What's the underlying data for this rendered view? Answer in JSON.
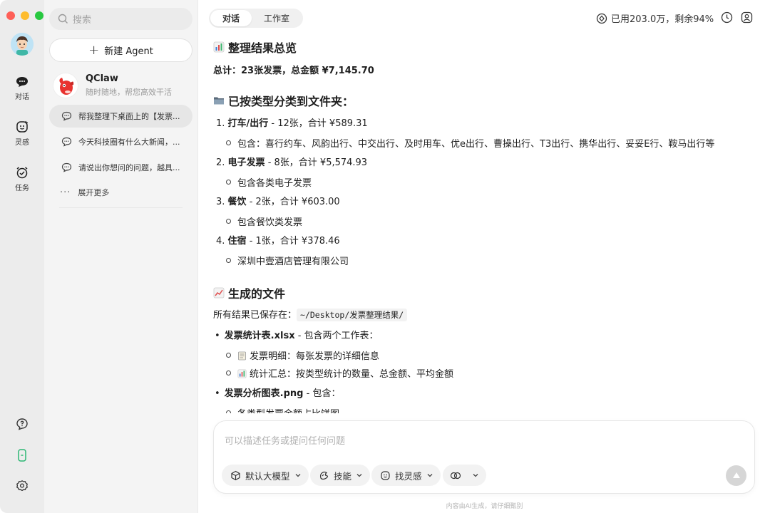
{
  "rail": {
    "items": [
      {
        "label": "对话"
      },
      {
        "label": "灵感"
      },
      {
        "label": "任务"
      }
    ]
  },
  "sidebar": {
    "search_placeholder": "搜索",
    "new_agent_label": "新建 Agent",
    "agent": {
      "name": "QClaw",
      "subtitle": "随时随地，帮您高效干活"
    },
    "conversations": [
      {
        "title": "帮我整理下桌面上的【发票..."
      },
      {
        "title": "今天科技圈有什么大新闻，..."
      },
      {
        "title": "请说出你想问的问题，越具..."
      }
    ],
    "more_label": "展开更多"
  },
  "header": {
    "tabs": [
      {
        "label": "对话"
      },
      {
        "label": "工作室"
      }
    ],
    "usage": "已用203.0万，剩余94%"
  },
  "message": {
    "h1": "整理结果总览",
    "total": "总计：23张发票，总金额 ¥7,145.70",
    "h2": "已按类型分类到文件夹：",
    "categories": [
      {
        "num": "1.",
        "name": "打车/出行",
        "detail": " - 12张，合计 ¥589.31",
        "sub": "包含：喜行约车、风韵出行、中交出行、及时用车、优e出行、曹操出行、T3出行、携华出行、妥妥E行、鞍马出行等"
      },
      {
        "num": "2.",
        "name": "电子发票",
        "detail": " - 8张，合计 ¥5,574.93",
        "sub": "包含各类电子发票"
      },
      {
        "num": "3.",
        "name": "餐饮",
        "detail": " - 2张，合计 ¥603.00",
        "sub": "包含餐饮类发票"
      },
      {
        "num": "4.",
        "name": "住宿",
        "detail": " - 1张，合计 ¥378.46",
        "sub": "深圳中壹酒店管理有限公司"
      }
    ],
    "h3": "生成的文件",
    "saved_prefix": "所有结果已保存在：",
    "saved_path": "~/Desktop/发票整理结果/",
    "files": [
      {
        "name": "发票统计表.xlsx",
        "detail": " - 包含两个工作表：",
        "subs": [
          "发票明细：每张发票的详细信息",
          "统计汇总：按类型统计的数量、总金额、平均金额"
        ]
      },
      {
        "name": "发票分析图表.png",
        "detail": " - 包含：",
        "subs": [
          "各类型发票金额占比饼图"
        ]
      }
    ]
  },
  "composer": {
    "placeholder": "可以描述任务或提问任何问题",
    "model_label": "默认大模型",
    "skills_label": "技能",
    "inspiration_label": "找灵感"
  },
  "footnote": "内容由AI生成，请仔细甄别"
}
